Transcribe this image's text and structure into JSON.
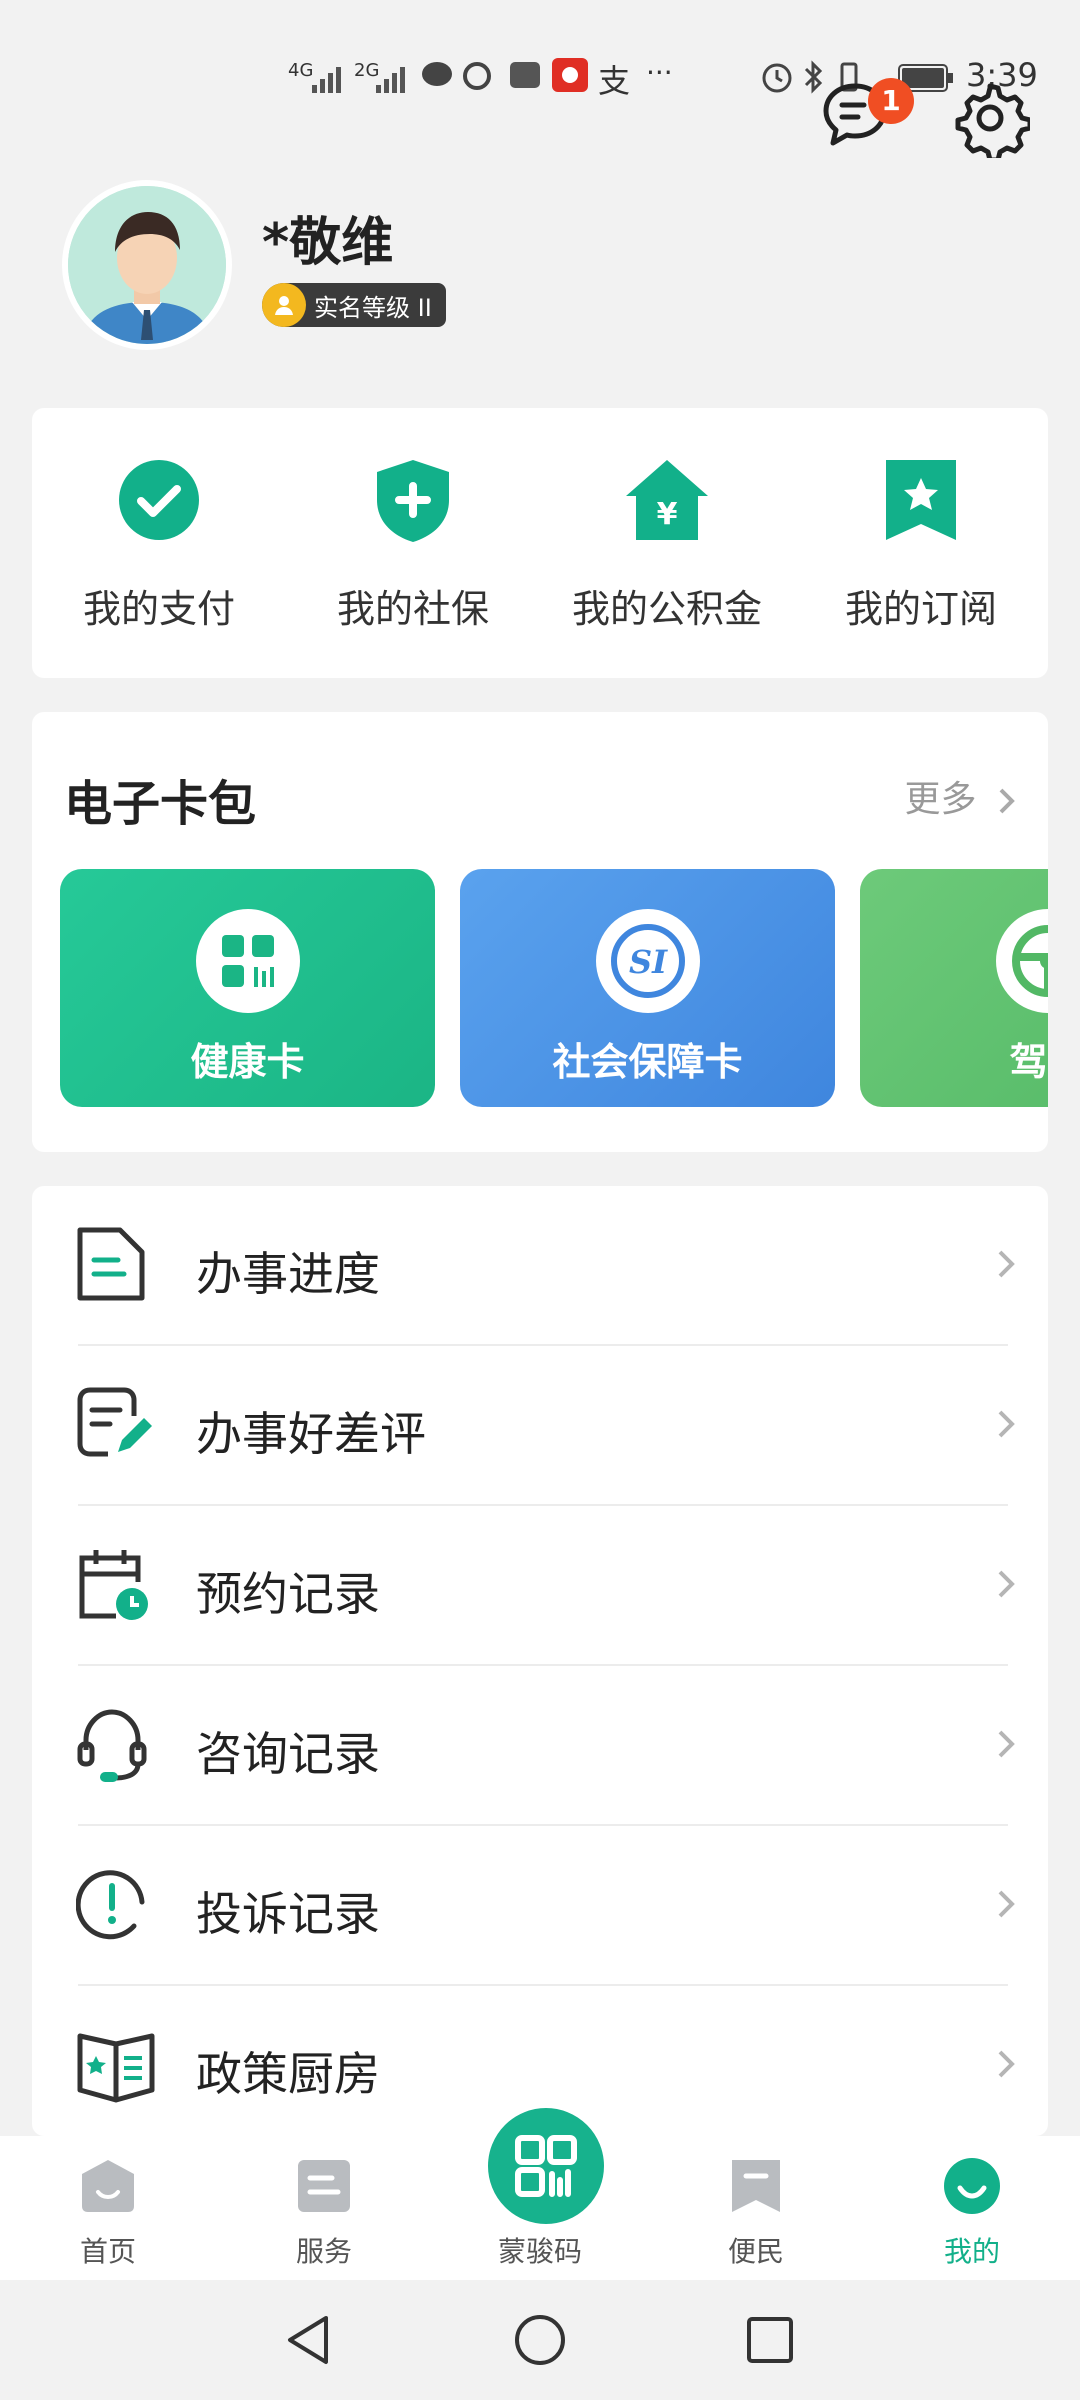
{
  "status_bar": {
    "net1": "4G",
    "net2": "2G",
    "ellipsis": "···",
    "pay_glyph": "支",
    "time": "3:39"
  },
  "header": {
    "message_badge": "1",
    "icons": [
      "message-icon",
      "gear-icon"
    ]
  },
  "profile": {
    "name": "*敬维",
    "verify_label": "实名等级 II"
  },
  "quick_actions": [
    {
      "label": "我的支付",
      "icon": "check-circle-icon"
    },
    {
      "label": "我的社保",
      "icon": "shield-plus-icon"
    },
    {
      "label": "我的公积金",
      "icon": "house-yuan-icon"
    },
    {
      "label": "我的订阅",
      "icon": "bookmark-star-icon"
    }
  ],
  "wallet": {
    "title": "电子卡包",
    "more": "更多",
    "cards": [
      {
        "label": "健康卡",
        "color": "#21c08f"
      },
      {
        "label": "社会保障卡",
        "color": "#4a92e6"
      },
      {
        "label": "驾驶",
        "color": "#5fc06e"
      }
    ]
  },
  "menu": [
    {
      "label": "办事进度",
      "icon": "document-icon"
    },
    {
      "label": "办事好差评",
      "icon": "review-edit-icon"
    },
    {
      "label": "预约记录",
      "icon": "calendar-clock-icon"
    },
    {
      "label": "咨询记录",
      "icon": "headset-icon"
    },
    {
      "label": "投诉记录",
      "icon": "alert-circle-icon"
    },
    {
      "label": "政策厨房",
      "icon": "open-book-icon"
    }
  ],
  "tabs": [
    {
      "label": "首页"
    },
    {
      "label": "服务"
    },
    {
      "label": "蒙骏码"
    },
    {
      "label": "便民"
    },
    {
      "label": "我的"
    }
  ],
  "colors": {
    "accent": "#12b08a",
    "badge": "#f04e23"
  }
}
